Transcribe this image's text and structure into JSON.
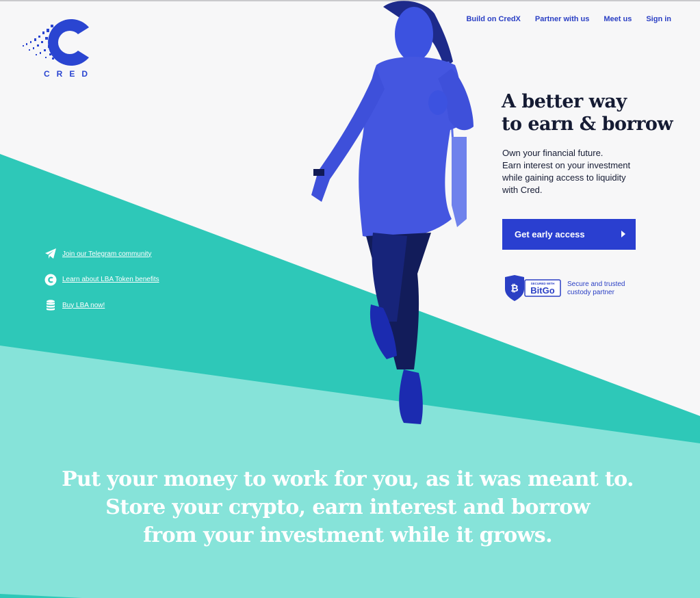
{
  "brand": {
    "name": "CRED",
    "primary_color": "#2a3fd0",
    "teal_dark": "#2ec8b8",
    "teal_light": "#86e3d9"
  },
  "nav": {
    "items": [
      {
        "label": "Build on CredX"
      },
      {
        "label": "Partner with us"
      },
      {
        "label": "Meet us"
      },
      {
        "label": "Sign in"
      }
    ]
  },
  "hero": {
    "title_lines": [
      "A better way",
      "to earn & borrow"
    ],
    "subtitle_lines": [
      "Own your financial future.",
      "Earn interest on your investment",
      "while gaining access to liquidity",
      "with Cred."
    ],
    "cta_label": "Get early access",
    "cta_icon": "play-arrow-icon"
  },
  "trust": {
    "badge_small": "SECURED WITH",
    "badge_big": "BitGo",
    "badge_icon": "bitcoin-shield-icon",
    "text_lines": [
      "Secure and trusted",
      "custody partner"
    ]
  },
  "side_links": [
    {
      "label": "Join our Telegram community",
      "icon": "telegram-icon"
    },
    {
      "label": "Learn about LBA Token benefits",
      "icon": "cred-token-icon"
    },
    {
      "label": "Buy LBA now!",
      "icon": "coins-stack-icon"
    }
  ],
  "bottom": {
    "headline_lines": [
      "Put your money to work for you, as it was meant to.",
      "Store your crypto, earn interest and borrow",
      "from your investment while it grows."
    ]
  }
}
